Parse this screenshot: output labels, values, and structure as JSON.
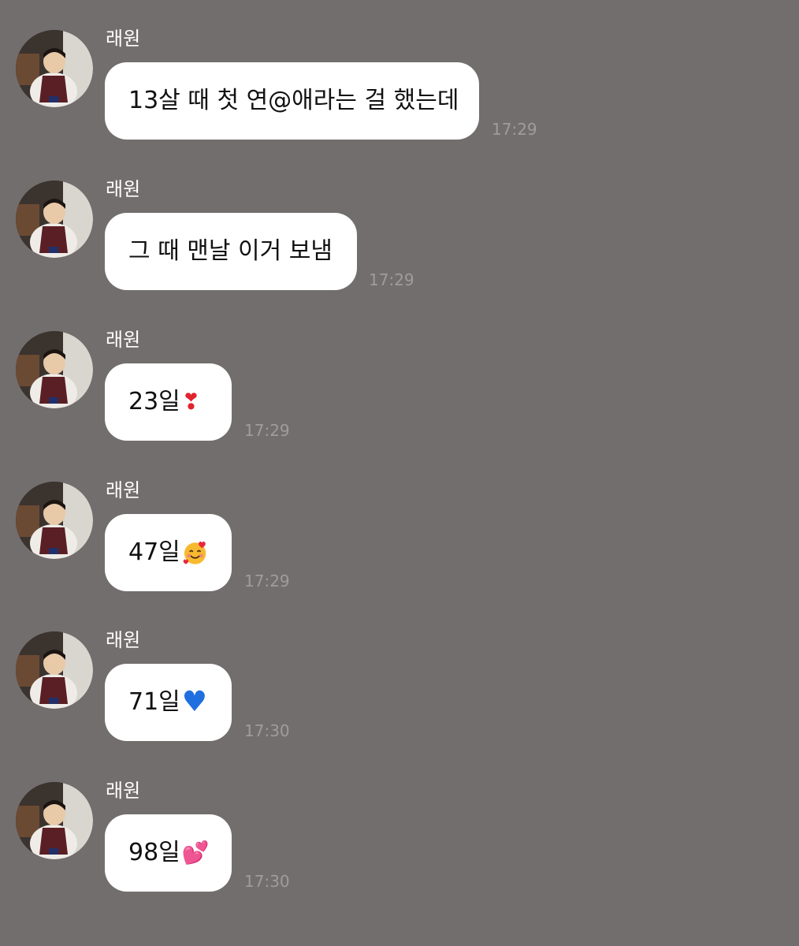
{
  "chat": {
    "messages": [
      {
        "sender": "래원",
        "text": "13살 때 첫 연@애라는 걸 했는데",
        "emoji": "",
        "time": "17:29"
      },
      {
        "sender": "래원",
        "text": "그 때 맨날 이거 보냄",
        "emoji": "",
        "time": "17:29"
      },
      {
        "sender": "래원",
        "text": "23일",
        "emoji": "❣",
        "emoji_name": "heart-exclamation-icon",
        "time": "17:29"
      },
      {
        "sender": "래원",
        "text": "47일",
        "emoji": "",
        "emoji_name": "smiling-face-with-hearts-icon",
        "time": "17:29"
      },
      {
        "sender": "래원",
        "text": "71일",
        "emoji": "♥",
        "emoji_name": "blue-heart-icon",
        "time": "17:30"
      },
      {
        "sender": "래원",
        "text": "98일",
        "emoji": "💕",
        "emoji_name": "two-hearts-icon",
        "time": "17:30"
      }
    ]
  },
  "colors": {
    "background": "#736e6e",
    "bubble": "#ffffff",
    "sender_text": "#ffffff",
    "time_text": "#a19c9c"
  }
}
